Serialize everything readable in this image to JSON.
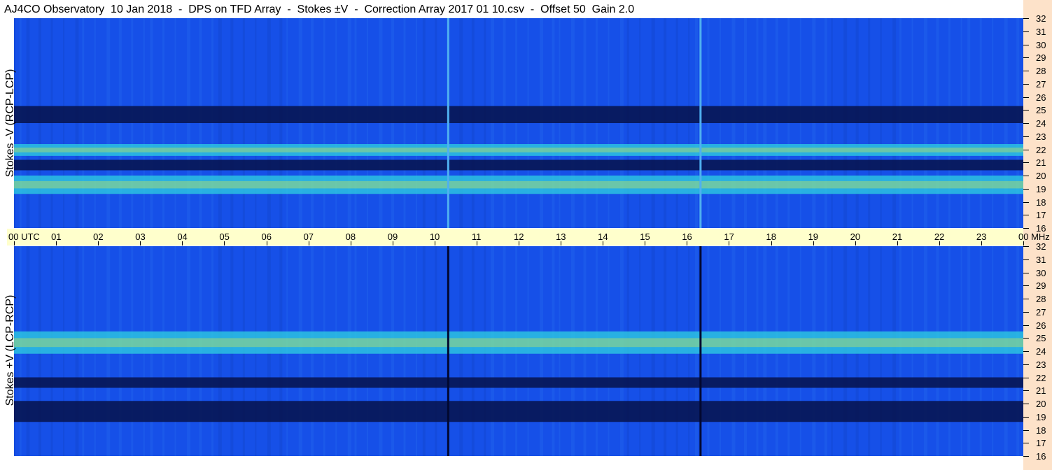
{
  "title": "AJ4CO Observatory  10 Jan 2018  -  DPS on TFD Array  -  Stokes ±V  -  Correction Array 2017 01 10.csv  -  Offset 50  Gain 2.0",
  "colors": {
    "time_bar": "#ffffcc",
    "right_strip": "#fde2c9",
    "spectrogram_low": "#06124a",
    "spectrogram_mid": "#1650e8",
    "spectrogram_high": "#e6f040"
  },
  "chart_data": [
    {
      "type": "heatmap",
      "ylabel": "Stokes -V (RCP-LCP)",
      "y_unit": "MHz",
      "ylim": [
        16,
        32
      ],
      "y_ticks": [
        "32",
        "31",
        "30",
        "29",
        "28",
        "27",
        "26",
        "25",
        "24",
        "23",
        "22",
        "21",
        "20",
        "19",
        "18",
        "17",
        "16"
      ],
      "xlim_utc_hours": [
        0,
        24
      ],
      "bands": [
        {
          "from": 24,
          "to": 25.3,
          "level": "dark"
        },
        {
          "from": 21.5,
          "to": 22.4,
          "level": "bright"
        },
        {
          "from": 20.4,
          "to": 21.2,
          "level": "dark"
        },
        {
          "from": 18.6,
          "to": 20.0,
          "level": "bright"
        }
      ],
      "vertical_lines_utc": [
        10.3,
        16.3
      ]
    },
    {
      "type": "heatmap",
      "ylabel": "Stokes +V (LCP-RCP)",
      "y_unit": "MHz",
      "ylim": [
        16,
        32
      ],
      "y_ticks": [
        "32",
        "31",
        "30",
        "29",
        "28",
        "27",
        "26",
        "25",
        "24",
        "23",
        "22",
        "21",
        "20",
        "19",
        "18",
        "17",
        "16"
      ],
      "xlim_utc_hours": [
        0,
        24
      ],
      "bands": [
        {
          "from": 23.8,
          "to": 25.5,
          "level": "bright"
        },
        {
          "from": 21.2,
          "to": 22.0,
          "level": "dark"
        },
        {
          "from": 18.6,
          "to": 20.2,
          "level": "dark"
        }
      ],
      "vertical_lines_utc": [
        10.3,
        16.3
      ]
    }
  ],
  "time_axis": {
    "labels": [
      "00 UTC",
      "01",
      "02",
      "03",
      "04",
      "05",
      "06",
      "07",
      "08",
      "09",
      "10",
      "11",
      "12",
      "13",
      "14",
      "15",
      "16",
      "17",
      "18",
      "19",
      "20",
      "21",
      "22",
      "23",
      "00 MHz"
    ]
  }
}
